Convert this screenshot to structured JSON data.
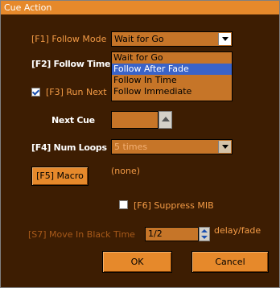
{
  "window": {
    "title": "Cue Action"
  },
  "f1": {
    "label": "[F1] Follow Mode",
    "selected": "Wait for Go",
    "options": [
      "Wait for Go",
      "Follow After Fade",
      "Follow In Time",
      "Follow Immediate"
    ],
    "highlighted_index": 1
  },
  "f2": {
    "label": "[F2] Follow Time"
  },
  "f3": {
    "label": "[F3] Run Next",
    "checked": true
  },
  "next_cue": {
    "label": "Next Cue",
    "value": ""
  },
  "f4": {
    "label": "[F4] Num Loops",
    "value": "5 times"
  },
  "f5": {
    "button_label": "[F5] Macro",
    "macro_value": "(none)"
  },
  "f6": {
    "label": "[F6] Suppress MIB",
    "checked": false
  },
  "s7": {
    "label": "[S7] Move In Black Time",
    "value": "1/2",
    "unit": "delay/fade"
  },
  "buttons": {
    "ok": "OK",
    "cancel": "Cancel"
  }
}
